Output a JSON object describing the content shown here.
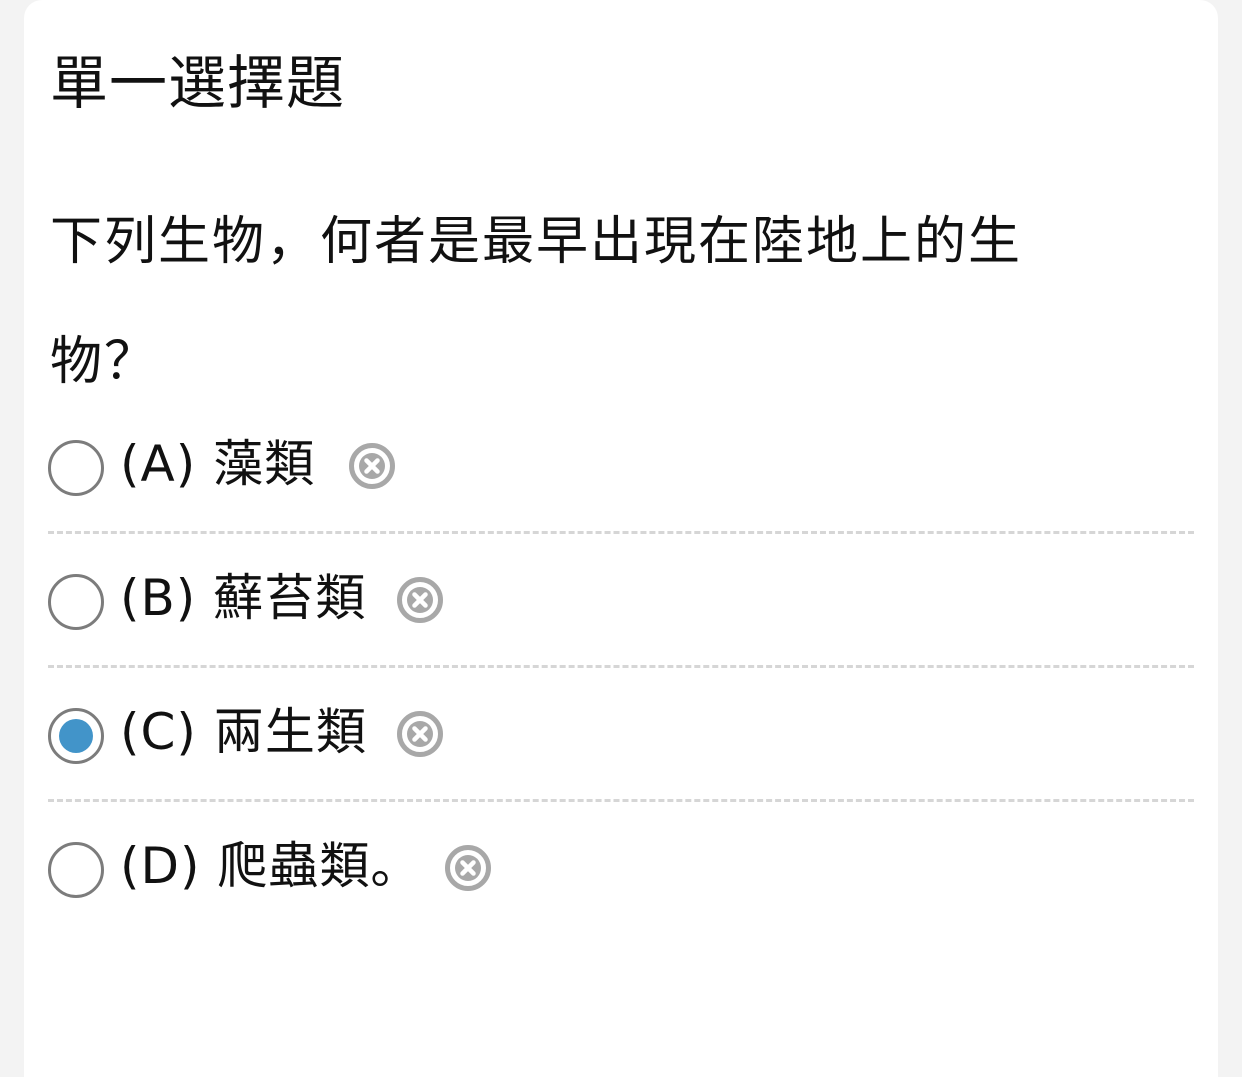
{
  "question_type": "單一選擇題",
  "question_line1": "下列生物，何者是最早出現在陸地上的生",
  "question_line2": "物？",
  "options": [
    {
      "label": "(A) 藻類",
      "selected": false
    },
    {
      "label": "(B) 蘚苔類",
      "selected": false
    },
    {
      "label": "(C) 兩生類",
      "selected": true
    },
    {
      "label": "(D) 爬蟲類。",
      "selected": false
    }
  ],
  "colors": {
    "selected_radio": "#4294c9",
    "remove_icon": "#a8a8a8",
    "divider": "#d6d6d6"
  }
}
